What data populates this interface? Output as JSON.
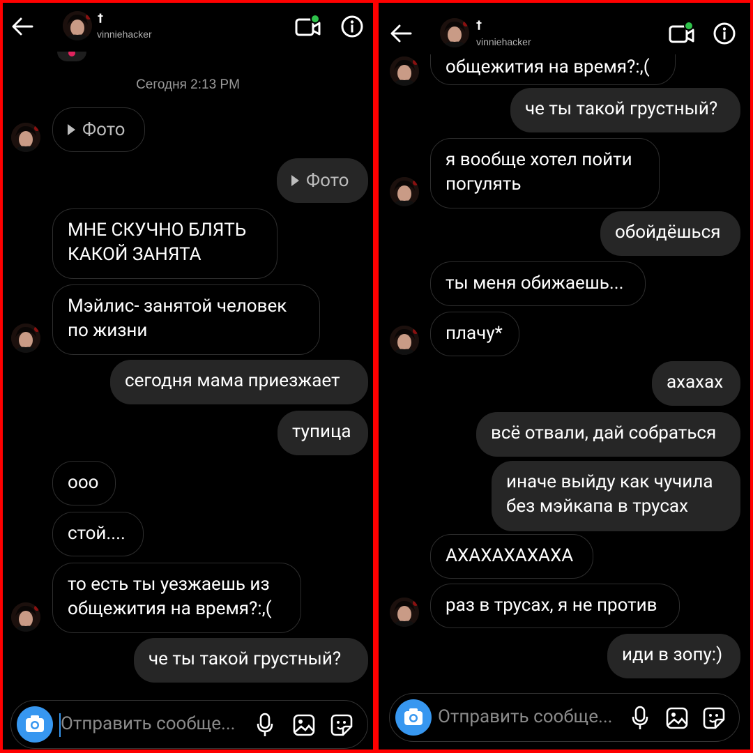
{
  "left": {
    "header": {
      "name": "vinniehacker",
      "cross": "†"
    },
    "timestamp": "Сегодня 2:13 PM",
    "messages": [
      {
        "text": "Фото"
      },
      {
        "text": "Фото"
      },
      {
        "text": "МНЕ СКУЧНО БЛЯТЬ\nКАКОЙ ЗАНЯТА"
      },
      {
        "text": "Мэйлис- занятой человек\nпо жизни"
      },
      {
        "text": "сегодня мама приезжает"
      },
      {
        "text": "тупица"
      },
      {
        "text": "ооо"
      },
      {
        "text": "стой...."
      },
      {
        "text": "то есть ты уезжаешь из\nобщежития на время?:,("
      },
      {
        "text": "че ты такой грустный?"
      }
    ],
    "composer": {
      "placeholder": "Отправить сообще..."
    }
  },
  "right": {
    "header": {
      "name": "vinniehacker",
      "cross": "†"
    },
    "messages": [
      {
        "text": "общежития на время?:,("
      },
      {
        "text": "че ты такой грустный?"
      },
      {
        "text": "я вообще хотел пойти\nпогулять"
      },
      {
        "text": "обойдёшься"
      },
      {
        "text": "ты меня обижаешь..."
      },
      {
        "text": "плачу*"
      },
      {
        "text": "ахахах"
      },
      {
        "text": "всё отвали, дай собраться"
      },
      {
        "text": "иначе выйду как чучила\nбез мэйкапа в трусах"
      },
      {
        "text": "АХАХАХАХАХА"
      },
      {
        "text": "раз в трусах, я не против"
      },
      {
        "text": "иди в зопу:)"
      }
    ],
    "composer": {
      "placeholder": "Отправить сообще..."
    }
  },
  "colors": {
    "background": "#000000",
    "outgoing_bubble": "#262626",
    "incoming_border": "#2e2e2e",
    "camera_button": "#3797f0",
    "online_dot": "#2ec24a",
    "frame": "#ff0000"
  },
  "icons": [
    "back-arrow-icon",
    "video-call-icon",
    "info-icon",
    "play-icon",
    "camera-icon",
    "microphone-icon",
    "gallery-icon",
    "sticker-icon"
  ]
}
